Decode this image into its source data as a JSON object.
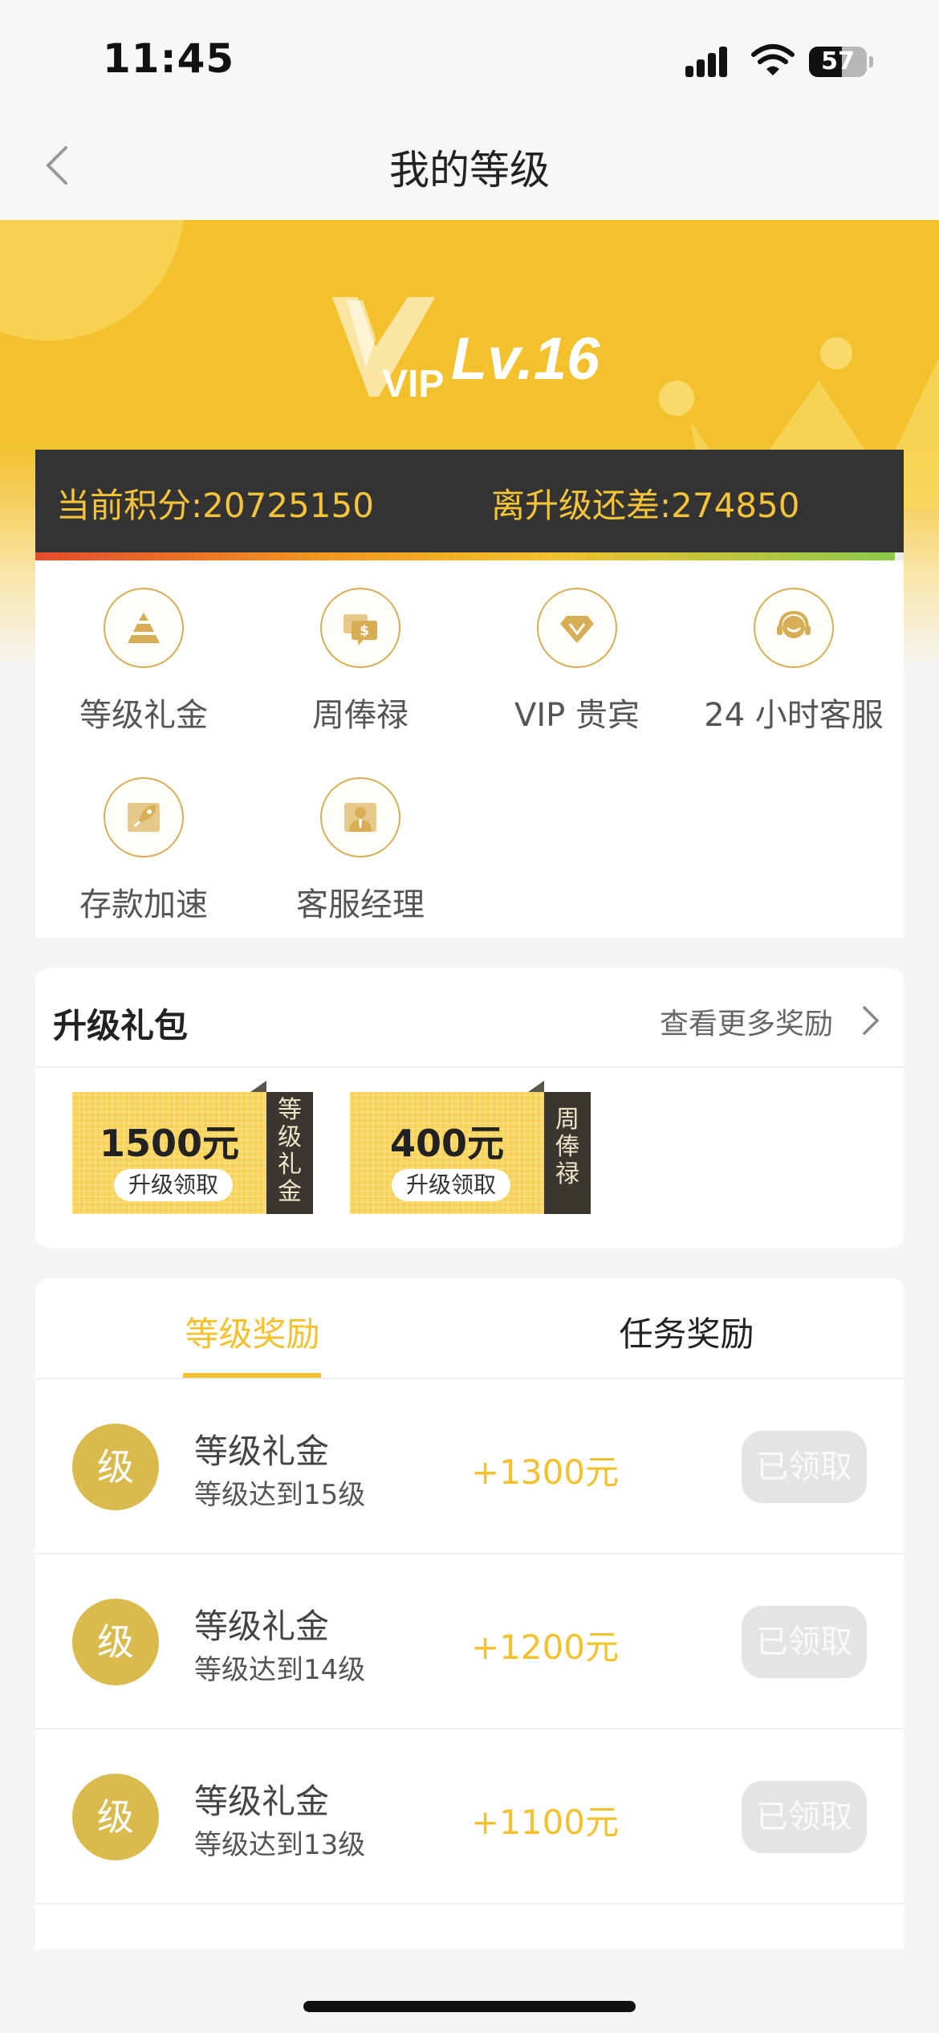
{
  "status_bar": {
    "time": "11:45",
    "battery_level": 57,
    "battery_text": "57",
    "icons": [
      "signal-icon",
      "wifi-icon",
      "battery-icon"
    ]
  },
  "nav": {
    "title": "我的等级",
    "back_icon": "chevron-left-icon"
  },
  "vip": {
    "logo_text": "VIP",
    "level_text": "Lv.16",
    "current_points_label": "当前积分:20725150",
    "points_to_upgrade_label": "离升级还差:274850",
    "progress": 0.99
  },
  "privileges": [
    {
      "label": "等级礼金",
      "icon": "pyramid-icon"
    },
    {
      "label": "周俸禄",
      "icon": "salary-chat-icon"
    },
    {
      "label": "VIP 贵宾",
      "icon": "diamond-icon"
    },
    {
      "label": "24 小时客服",
      "icon": "headset-icon"
    },
    {
      "label": "存款加速",
      "icon": "rocket-icon"
    },
    {
      "label": "客服经理",
      "icon": "manager-icon"
    }
  ],
  "upgrade_gift": {
    "title": "升级礼包",
    "more_label": "查看更多奖励",
    "vouchers": [
      {
        "amount": "1500元",
        "action": "升级领取",
        "tag": "等级礼金"
      },
      {
        "amount": "400元",
        "action": "升级领取",
        "tag": "周俸禄"
      }
    ]
  },
  "rewards": {
    "tabs": [
      {
        "label": "等级奖励",
        "active": true
      },
      {
        "label": "任务奖励",
        "active": false
      }
    ],
    "items": [
      {
        "badge": "级",
        "title": "等级礼金",
        "subtitle": "等级达到15级",
        "amount": "+1300元",
        "button": "已领取"
      },
      {
        "badge": "级",
        "title": "等级礼金",
        "subtitle": "等级达到14级",
        "amount": "+1200元",
        "button": "已领取"
      },
      {
        "badge": "级",
        "title": "等级礼金",
        "subtitle": "等级达到13级",
        "amount": "+1100元",
        "button": "已领取"
      }
    ]
  },
  "colors": {
    "brand_yellow": "#f2c12d",
    "dark_bar": "#333333",
    "badge_gold": "#d9ba4c",
    "claimed_gray": "#e4e4e4"
  }
}
